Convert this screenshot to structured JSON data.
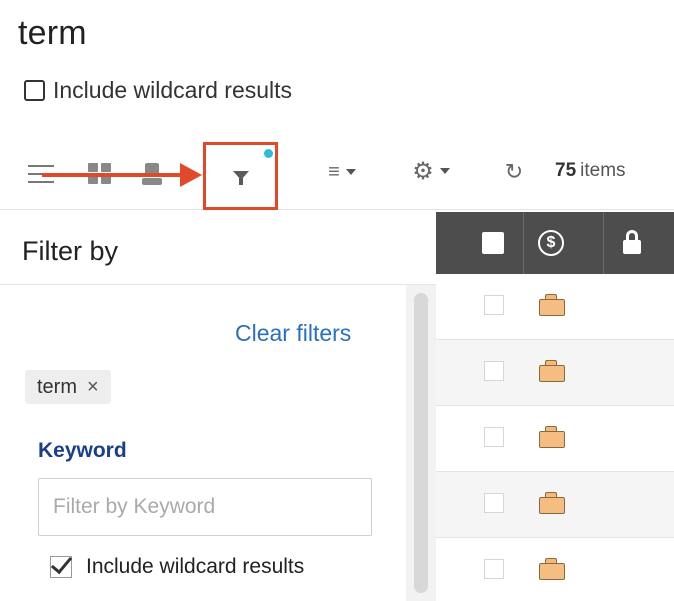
{
  "page": {
    "title": "term",
    "include_wildcard_label": "Include wildcard results",
    "include_wildcard_checked": false
  },
  "toolbar": {
    "item_count_number": "75",
    "item_count_suffix": "items",
    "filter_indicator_color": "#2bbfd6",
    "highlight_color": "#e04a2a",
    "icons": [
      "list-view-icon",
      "grid-view-icon",
      "thumbnail-view-icon",
      "filter-icon",
      "sort-icon",
      "gear-icon",
      "refresh-icon"
    ]
  },
  "filter_panel": {
    "title": "Filter by",
    "clear_filters": "Clear filters",
    "active_chip": {
      "label": "term",
      "remove": "×"
    },
    "keyword_section": {
      "label": "Keyword",
      "placeholder": "Filter by Keyword",
      "value": "",
      "wildcard_label": "Include wildcard results",
      "wildcard_checked": true
    }
  },
  "results": {
    "header_icons": [
      "select-all-checkbox",
      "dollar-icon",
      "lock-icon"
    ],
    "rows": [
      {
        "icon": "folder-icon"
      },
      {
        "icon": "folder-icon"
      },
      {
        "icon": "folder-icon"
      },
      {
        "icon": "folder-icon"
      },
      {
        "icon": "folder-icon"
      }
    ]
  }
}
